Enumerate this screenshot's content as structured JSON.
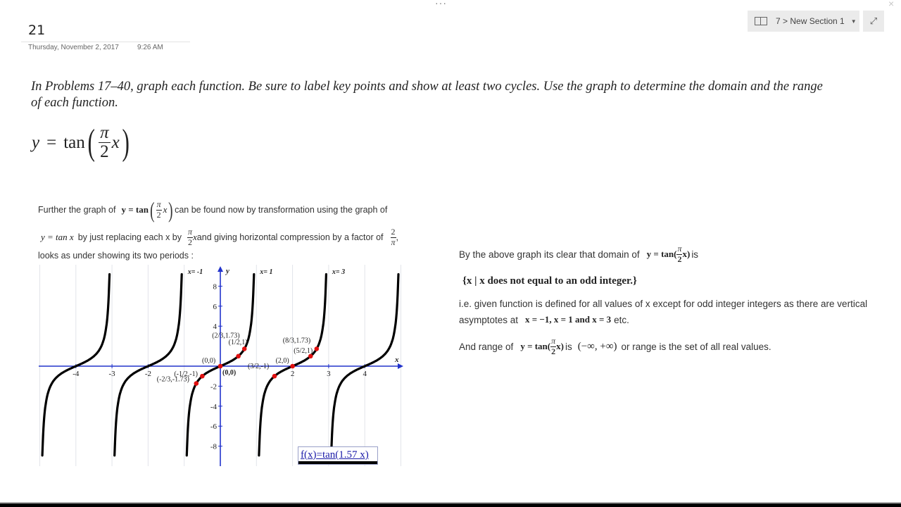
{
  "page": {
    "title": "21",
    "date": "Thursday, November 2, 2017",
    "time": "9:26 AM"
  },
  "toolbar": {
    "more_label": "···",
    "close_label": "×",
    "notebook_icon": "notebook-icon",
    "notebook_label": "7 > New Section 1",
    "dropdown_icon": "▼",
    "expand_icon": "⤢"
  },
  "problem": {
    "instructions": "In Problems 17–40, graph each function. Be sure to label key points and show at least two cycles. Use the graph to determine the domain and the range of each function.",
    "eq_lhs": "y",
    "eq_eq": "=",
    "eq_fn": "tan",
    "eq_num": "π",
    "eq_den": "2",
    "eq_var": "x"
  },
  "explanation": {
    "p1_a": "Further the graph of",
    "p1_eq_y": "y = tan",
    "p1_b": "can be found now by transformation using the graph of",
    "p2_eq": "y = tan x",
    "p2_a": "by just replacing each x by",
    "p2_b": "and giving horizontal compression by a factor of",
    "p2_frac_num": "2",
    "p2_frac_den": "π",
    "p2_c": ",",
    "p3": "looks as under showing its two periods :",
    "pi": "π",
    "two": "2",
    "x": "x"
  },
  "conclusion": {
    "domain_a": "By the above graph its clear that domain of",
    "domain_eq": "y = tan(",
    "domain_eq_end": "x)",
    "domain_b": "is",
    "domain_set": "{x | x does not equal to an odd integer.}",
    "ie_line1": "i.e. given function is defined for all values of x except for odd integer integers as there are vertical",
    "ie_line2_a": "asymptotes at",
    "ie_line2_eq": "x = −1, x = 1 and x = 3",
    "ie_line2_b": "etc.",
    "range_a": "And range of",
    "range_b": "is",
    "range_interval": "(−∞, +∞)",
    "range_c": "or range is the set of all real values."
  },
  "graph": {
    "legend": "f(x)=tan(1.57  x)"
  },
  "chart_data": {
    "type": "line",
    "title": "",
    "function": "f(x)=tan(1.57 x)",
    "xlabel": "x",
    "ylabel": "y",
    "xlim": [
      -5.1,
      5.0
    ],
    "ylim": [
      -9.8,
      9.6
    ],
    "x_ticks": [
      -4,
      -3,
      -2,
      2,
      3,
      4
    ],
    "y_ticks": [
      8,
      6,
      4,
      -2,
      -4,
      -6,
      -8
    ],
    "asymptotes": [
      -5,
      -3,
      -1,
      1,
      3,
      5
    ],
    "asymptote_labels": [
      {
        "x": -1,
        "text": "x= -1"
      },
      {
        "x": 1,
        "text": "x= 1"
      },
      {
        "x": 3,
        "text": "x= 3"
      }
    ],
    "grid": true,
    "key_points": [
      {
        "x": 0,
        "y": 0,
        "label": "(0,0)"
      },
      {
        "x": 0.5,
        "y": 1,
        "label": "(1/2,1)"
      },
      {
        "x": 0.6667,
        "y": 1.73,
        "label": "(2/3,1.73)"
      },
      {
        "x": -0.5,
        "y": -1,
        "label": "(-1/2,-1)"
      },
      {
        "x": -0.6667,
        "y": -1.73,
        "label": "(-2/3,-1.73)"
      },
      {
        "x": 2,
        "y": 0,
        "label": "(2,0)"
      },
      {
        "x": 2.5,
        "y": 1,
        "label": "(5/2,1)"
      },
      {
        "x": 2.6667,
        "y": 1.73,
        "label": "(8/3,1.73)"
      },
      {
        "x": 1.5,
        "y": -1,
        "label": "(3/2,-1)"
      }
    ],
    "origin_label": "(0,0)",
    "legend": "f(x)=tan(1.57  x)",
    "legend_position": "bottom-right"
  }
}
